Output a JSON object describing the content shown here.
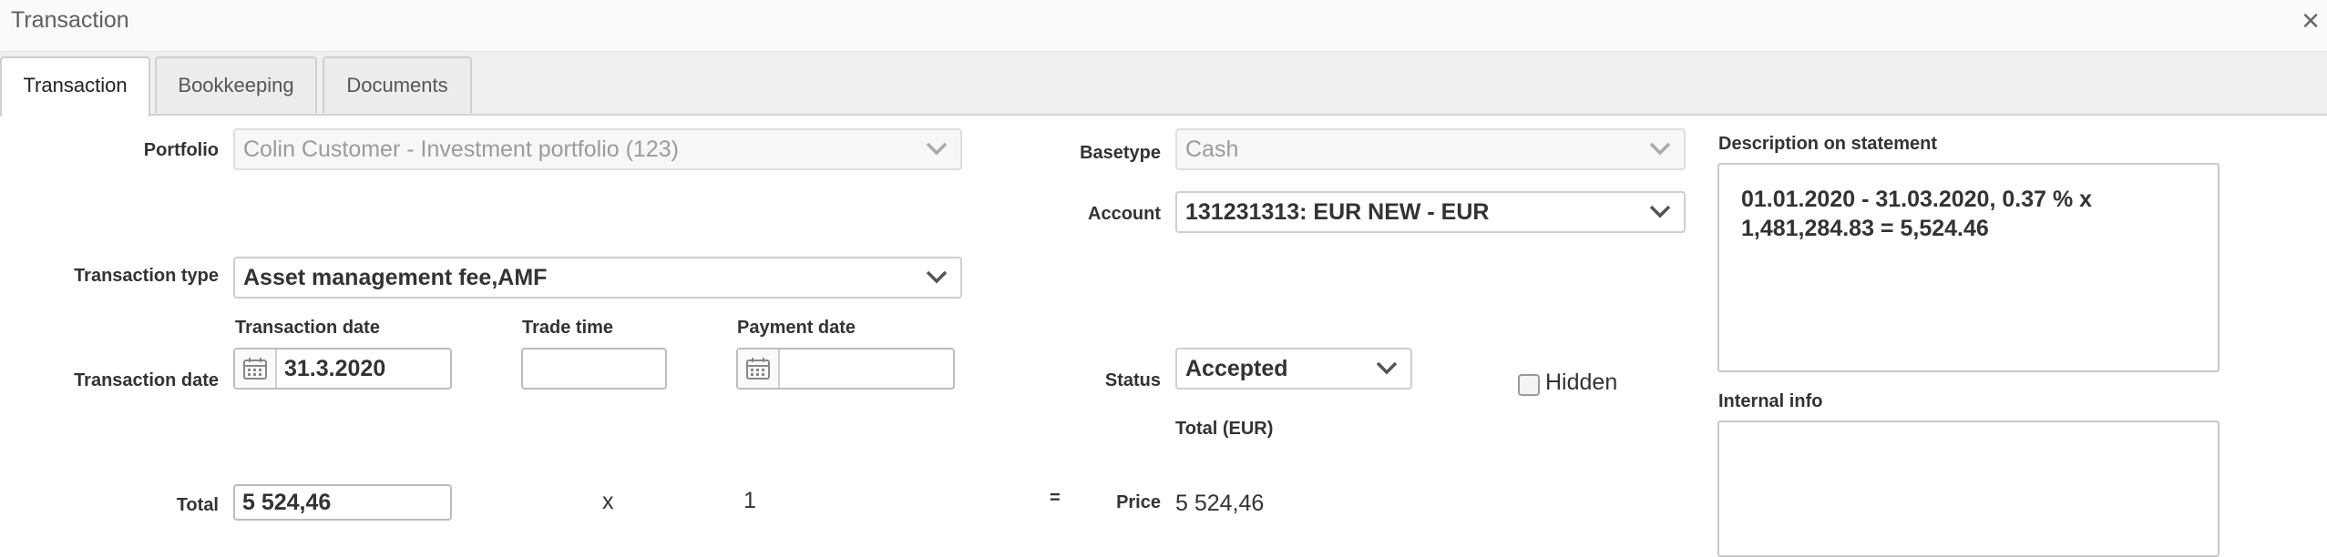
{
  "window": {
    "title": "Transaction",
    "close_glyph": "×"
  },
  "tabs": [
    {
      "label": "Transaction",
      "active": true
    },
    {
      "label": "Bookkeeping",
      "active": false
    },
    {
      "label": "Documents",
      "active": false
    }
  ],
  "form": {
    "portfolio": {
      "label": "Portfolio",
      "value": "Colin Customer - Investment portfolio (123)",
      "disabled": true
    },
    "transaction_type": {
      "label": "Transaction type",
      "value": "Asset management fee,AMF"
    },
    "transaction_date_row": {
      "label": "Transaction date",
      "transaction_date": {
        "label": "Transaction date",
        "value": "31.3.2020"
      },
      "trade_time": {
        "label": "Trade time",
        "value": ""
      },
      "payment_date": {
        "label": "Payment date",
        "value": ""
      }
    },
    "total": {
      "label": "Total",
      "value": "5 524,46",
      "multiply_sign": "x",
      "quantity": "1",
      "equals_sign": "="
    },
    "basetype": {
      "label": "Basetype",
      "value": "Cash",
      "disabled": true
    },
    "account": {
      "label": "Account",
      "value": "131231313: EUR NEW - EUR"
    },
    "status": {
      "label": "Status",
      "value": "Accepted"
    },
    "hidden": {
      "label": "Hidden",
      "checked": false
    },
    "total_eur_label": "Total (EUR)",
    "price": {
      "label": "Price",
      "value": "5 524,46"
    },
    "description": {
      "label": "Description on statement",
      "value": "01.01.2020 - 31.03.2020,  0.37 % x 1,481,284.83 = 5,524.46"
    },
    "internal_info": {
      "label": "Internal info",
      "value": ""
    }
  },
  "icons": {
    "close": "close-icon",
    "dropdown": "chevron-down-icon",
    "calendar": "calendar-icon"
  }
}
